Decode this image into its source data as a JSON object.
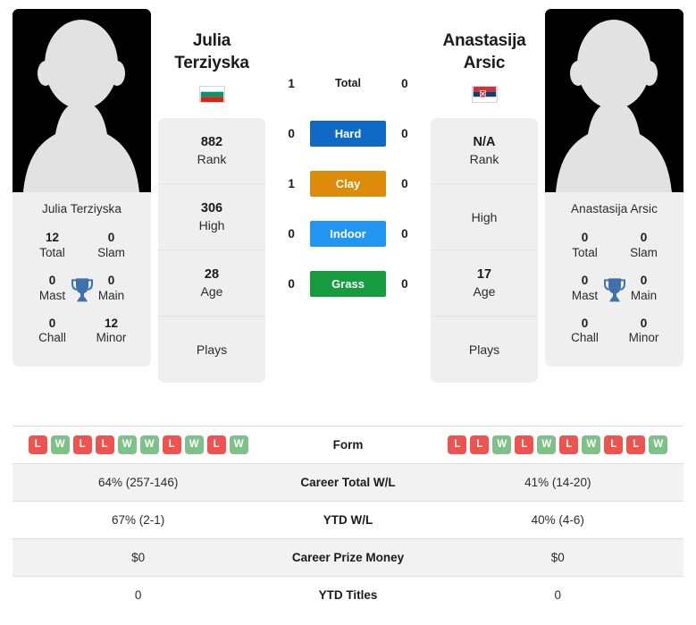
{
  "colors": {
    "hard": "#1069c4",
    "clay": "#dd8c0a",
    "indoor": "#2196f3",
    "grass": "#169b3e",
    "win": "#7fc289",
    "loss": "#ef5350",
    "trophy": "#3f72ac",
    "panel": "#efefef"
  },
  "players": {
    "left": {
      "first_name": "Julia",
      "last_name": "Terziyska",
      "full_name": "Julia Terziyska",
      "country": "Bulgaria",
      "flag_icon": "flag-bulgaria",
      "titles": [
        {
          "num": "12",
          "label": "Total"
        },
        {
          "num": "0",
          "label": "Slam"
        },
        {
          "num": "0",
          "label": "Mast"
        },
        {
          "num": "0",
          "label": "Main"
        },
        {
          "num": "0",
          "label": "Chall"
        },
        {
          "num": "12",
          "label": "Minor"
        }
      ],
      "stats": [
        {
          "num": "882",
          "label": "Rank"
        },
        {
          "num": "306",
          "label": "High"
        },
        {
          "num": "28",
          "label": "Age"
        },
        {
          "num": "",
          "label": "Plays"
        }
      ],
      "form": [
        "L",
        "W",
        "L",
        "L",
        "W",
        "W",
        "L",
        "W",
        "L",
        "W"
      ]
    },
    "right": {
      "first_name": "Anastasija",
      "last_name": "Arsic",
      "full_name": "Anastasija Arsic",
      "country": "Serbia",
      "flag_icon": "flag-serbia",
      "titles": [
        {
          "num": "0",
          "label": "Total"
        },
        {
          "num": "0",
          "label": "Slam"
        },
        {
          "num": "0",
          "label": "Mast"
        },
        {
          "num": "0",
          "label": "Main"
        },
        {
          "num": "0",
          "label": "Chall"
        },
        {
          "num": "0",
          "label": "Minor"
        }
      ],
      "stats": [
        {
          "num": "N/A",
          "label": "Rank"
        },
        {
          "num": "",
          "label": "High"
        },
        {
          "num": "17",
          "label": "Age"
        },
        {
          "num": "",
          "label": "Plays"
        }
      ],
      "form": [
        "L",
        "L",
        "W",
        "L",
        "W",
        "L",
        "W",
        "L",
        "L",
        "W"
      ]
    }
  },
  "h2h": [
    {
      "label": "Total",
      "left": "1",
      "right": "0",
      "style": "plain"
    },
    {
      "label": "Hard",
      "left": "0",
      "right": "0",
      "style": "hard"
    },
    {
      "label": "Clay",
      "left": "1",
      "right": "0",
      "style": "clay"
    },
    {
      "label": "Indoor",
      "left": "0",
      "right": "0",
      "style": "indoor"
    },
    {
      "label": "Grass",
      "left": "0",
      "right": "0",
      "style": "grass"
    }
  ],
  "table": {
    "form_label": "Form",
    "rows": [
      {
        "label": "Career Total W/L",
        "left": "64% (257-146)",
        "right": "41% (14-20)"
      },
      {
        "label": "YTD W/L",
        "left": "67% (2-1)",
        "right": "40% (4-6)"
      },
      {
        "label": "Career Prize Money",
        "left": "$0",
        "right": "$0"
      },
      {
        "label": "YTD Titles",
        "left": "0",
        "right": "0"
      }
    ]
  }
}
